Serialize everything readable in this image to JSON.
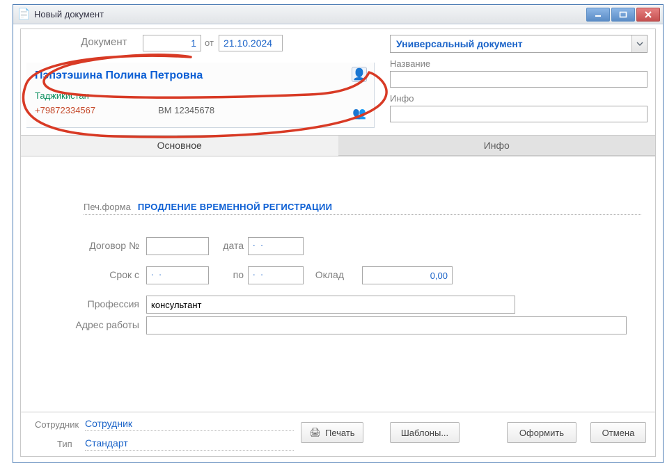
{
  "window": {
    "title": "Новый документ"
  },
  "header": {
    "doc_label": "Документ",
    "doc_number": "1",
    "ot_label": "от",
    "doc_date": "21.10.2024"
  },
  "doctype": {
    "value": "Универсальный документ"
  },
  "right_fields": {
    "name_label": "Название",
    "name_value": "",
    "info_label": "Инфо",
    "info_value": ""
  },
  "person": {
    "name": "Пэпэтэшина Полина Петровна",
    "country": "Таджикистан",
    "phone": "+79872334567",
    "passport": "ВМ 12345678"
  },
  "tabs": {
    "main": "Основное",
    "info": "Инфо"
  },
  "printform": {
    "label": "Печ.форма",
    "value": "ПРОДЛЕНИЕ ВРЕМЕННОЙ РЕГИСТРАЦИИ"
  },
  "contract": {
    "no_label": "Договор №",
    "no_value": "",
    "date_label": "дата",
    "date_value": ". .",
    "term_label": "Срок с",
    "term_from": ". .",
    "to_label": "по",
    "term_to": ". .",
    "salary_label": "Оклад",
    "salary_value": "0,00",
    "profession_label": "Профессия",
    "profession_value": "консультант",
    "address_label": "Адрес работы",
    "address_value": ""
  },
  "footer": {
    "employee_label": "Сотрудник",
    "employee_value": "Сотрудник",
    "type_label": "Тип",
    "type_value": "Стандарт"
  },
  "buttons": {
    "print": "Печать",
    "templates": "Шаблоны...",
    "submit": "Оформить",
    "cancel": "Отмена"
  }
}
